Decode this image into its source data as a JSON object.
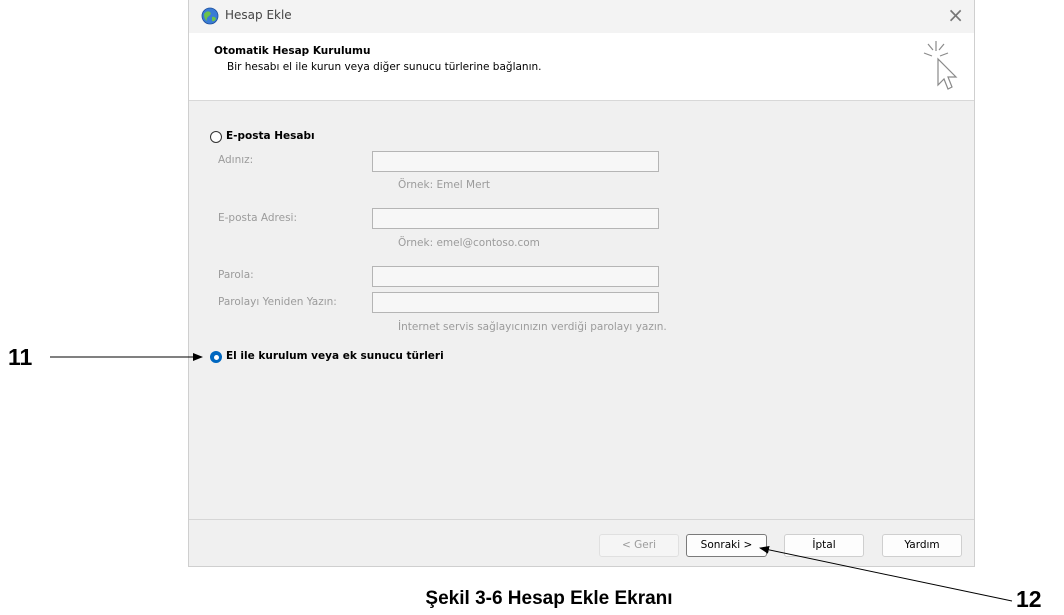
{
  "window": {
    "title": "Hesap Ekle",
    "close_glyph": "×",
    "icon": "outlook-globe-icon"
  },
  "header": {
    "title": "Otomatik Hesap Kurulumu",
    "subtitle": "Bir hesabı el ile kurun veya diğer sunucu türlerine bağlanın."
  },
  "email_option": {
    "label": "E-posta Hesabı",
    "selected": false,
    "fields": {
      "name_label": "Adınız:",
      "name_value": "",
      "name_hint": "Örnek: Emel Mert",
      "email_label": "E-posta Adresi:",
      "email_value": "",
      "email_hint": "Örnek: emel@contoso.com",
      "password_label": "Parola:",
      "password_value": "",
      "password_repeat_label": "Parolayı Yeniden Yazın:",
      "password_repeat_value": "",
      "password_hint": "İnternet servis sağlayıcınızın verdiği parolayı yazın."
    }
  },
  "manual_option": {
    "label": "El ile kurulum veya ek sunucu türleri",
    "selected": true
  },
  "buttons": {
    "back": "< Geri",
    "next": "Sonraki >",
    "cancel": "İptal",
    "help": "Yardım"
  },
  "annotations": {
    "left_number": "11",
    "right_number": "12"
  },
  "caption": "Şekil 3-6 Hesap Ekle Ekranı",
  "colors": {
    "accent": "#0067c0",
    "disabled_text": "#9b9b9b"
  }
}
